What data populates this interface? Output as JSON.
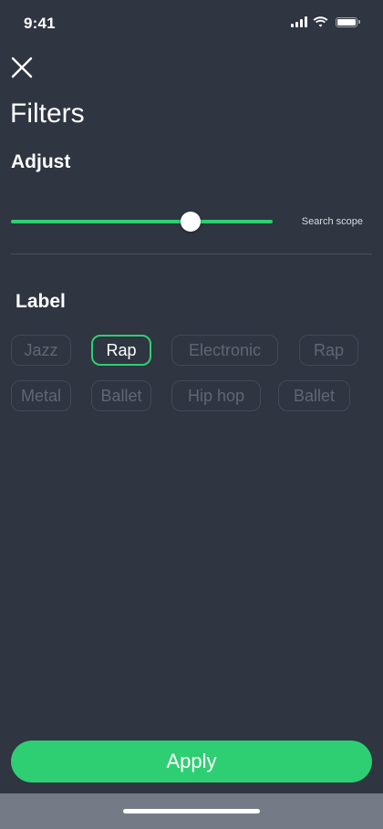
{
  "status_bar": {
    "time": "9:41"
  },
  "header": {
    "close_icon": "close-icon",
    "title": "Filters"
  },
  "adjust": {
    "heading": "Adjust",
    "slider_value_fraction": 0.686,
    "slider_caption": "Search scope"
  },
  "label_section": {
    "heading": "Label",
    "chips": [
      {
        "label": "Jazz",
        "selected": false
      },
      {
        "label": "Rap",
        "selected": true
      },
      {
        "label": "Electronic",
        "selected": false
      },
      {
        "label": "Rap",
        "selected": false
      },
      {
        "label": "Metal",
        "selected": false
      },
      {
        "label": "Ballet",
        "selected": false
      },
      {
        "label": "Hip hop",
        "selected": false
      },
      {
        "label": "Ballet",
        "selected": false
      }
    ]
  },
  "footer": {
    "apply_label": "Apply"
  },
  "colors": {
    "background": "#2f3541",
    "accent": "#2ecf73",
    "chip_border": "#434957",
    "chip_text_inactive": "#606673",
    "home_bar_area": "#757b86"
  }
}
